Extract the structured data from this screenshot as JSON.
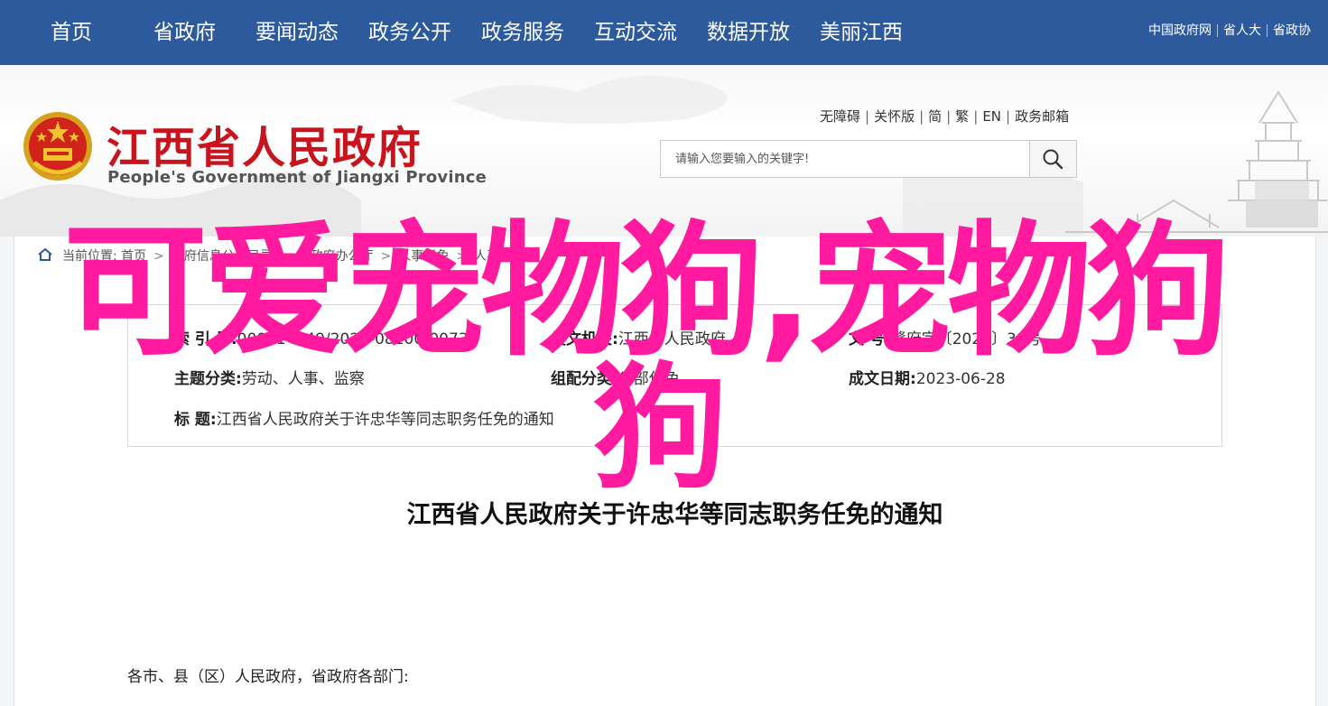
{
  "topnav": {
    "items": [
      "首页",
      "省政府",
      "要闻动态",
      "政务公开",
      "政务服务",
      "互动交流",
      "数据开放",
      "美丽江西"
    ],
    "links": [
      "中国政府网",
      "省人大",
      "省政协"
    ]
  },
  "header": {
    "title": "江西省人民政府",
    "subtitle": "People's Government of Jiangxi Province",
    "util_links": [
      "无障碍",
      "关怀版",
      "简",
      "繁",
      "EN",
      "政务邮箱"
    ],
    "search_placeholder": "请输入您要输入的关键字!"
  },
  "breadcrumb": {
    "label": "当前位置:",
    "items": [
      "首页",
      "政府信息公开目录",
      "省政府办公厅",
      "人事任免",
      "人事任免"
    ]
  },
  "meta": {
    "index_label": "索  引  号:",
    "index_value": "000014349/2023-08100-00732",
    "issuer_label": "发文机关:",
    "issuer_value": "江西省人民政府",
    "doc_no_label": "文    号:",
    "doc_no_value": "赣府字〔2023〕38号",
    "category_label": "主题分类:",
    "category_value": "劳动、人事、监察",
    "compose_label": "组配分类:",
    "compose_value": "省部任免",
    "date_label": "成文日期:",
    "date_value": "2023-06-28",
    "title_label": "标        题:",
    "title_value": "江西省人民政府关于许忠华等同志职务任免的通知"
  },
  "article": {
    "title": "江西省人民政府关于许忠华等同志职务任免的通知",
    "greeting": "各市、县（区）人民政府，省政府各部门:"
  },
  "overlay": {
    "line1": "可爱宠物狗,宠物狗",
    "line2": "狗",
    "color": "#ff1aa0"
  },
  "colors": {
    "nav_bg": "#2c5a9c",
    "brand_red": "#c8151d"
  }
}
